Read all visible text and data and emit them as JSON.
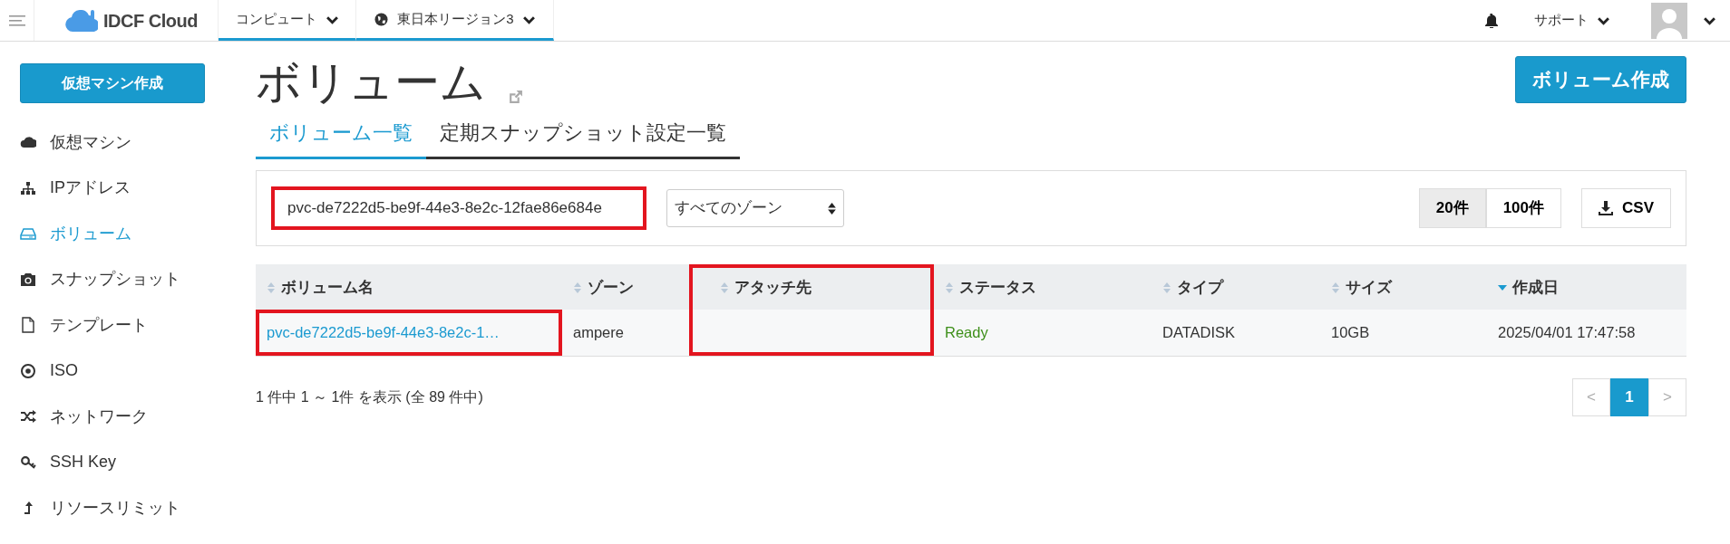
{
  "topbar": {
    "logo": "IDCF Cloud",
    "menus": [
      {
        "label": "コンピュート",
        "kind": "plain",
        "selected": true
      },
      {
        "label": "東日本リージョン3",
        "kind": "globe",
        "selected": true
      }
    ],
    "support": "サポート"
  },
  "sidebar": {
    "create_button": "仮想マシン作成",
    "items": [
      {
        "label": "仮想マシン",
        "selected": false
      },
      {
        "label": "IPアドレス",
        "selected": false
      },
      {
        "label": "ボリューム",
        "selected": true
      },
      {
        "label": "スナップショット",
        "selected": false
      },
      {
        "label": "テンプレート",
        "selected": false
      },
      {
        "label": "ISO",
        "selected": false
      },
      {
        "label": "ネットワーク",
        "selected": false
      },
      {
        "label": "SSH Key",
        "selected": false
      },
      {
        "label": "リソースリミット",
        "selected": false
      }
    ]
  },
  "page": {
    "title": "ボリューム",
    "create_button": "ボリューム作成"
  },
  "tabs": [
    {
      "label": "ボリューム一覧",
      "selected": true
    },
    {
      "label": "定期スナップショット設定一覧",
      "selected": false
    }
  ],
  "filter": {
    "search_value": "pvc-de7222d5-be9f-44e3-8e2c-12fae86e684e",
    "search_highlighted": true,
    "zone_select": "すべてのゾーン",
    "page_sizes": [
      {
        "label": "20件",
        "selected": true
      },
      {
        "label": "100件",
        "selected": false
      }
    ],
    "csv_button": "CSV"
  },
  "table": {
    "columns": [
      {
        "label": "ボリューム名",
        "sorted": false,
        "highlighted": false
      },
      {
        "label": "ゾーン",
        "sorted": false,
        "highlighted": false
      },
      {
        "label": "アタッチ先",
        "sorted": false,
        "highlighted": true
      },
      {
        "label": "ステータス",
        "sorted": false,
        "highlighted": false
      },
      {
        "label": "タイプ",
        "sorted": false,
        "highlighted": false
      },
      {
        "label": "サイズ",
        "sorted": false,
        "highlighted": false
      },
      {
        "label": "作成日",
        "sorted": true,
        "highlighted": false
      }
    ],
    "rows": [
      {
        "name": "pvc-de7222d5-be9f-44e3-8e2c-1…",
        "name_highlighted": true,
        "zone": "ampere",
        "attached_to": "",
        "status": "Ready",
        "status_ok": true,
        "type": "DATADISK",
        "size": "10GB",
        "created": "2025/04/01 17:47:58"
      }
    ]
  },
  "summary": "1 件中 1 ～ 1件 を表示 (全 89 件中)",
  "pagination": {
    "prev": "<",
    "pages": [
      {
        "label": "1",
        "selected": true
      }
    ],
    "next": ">"
  }
}
